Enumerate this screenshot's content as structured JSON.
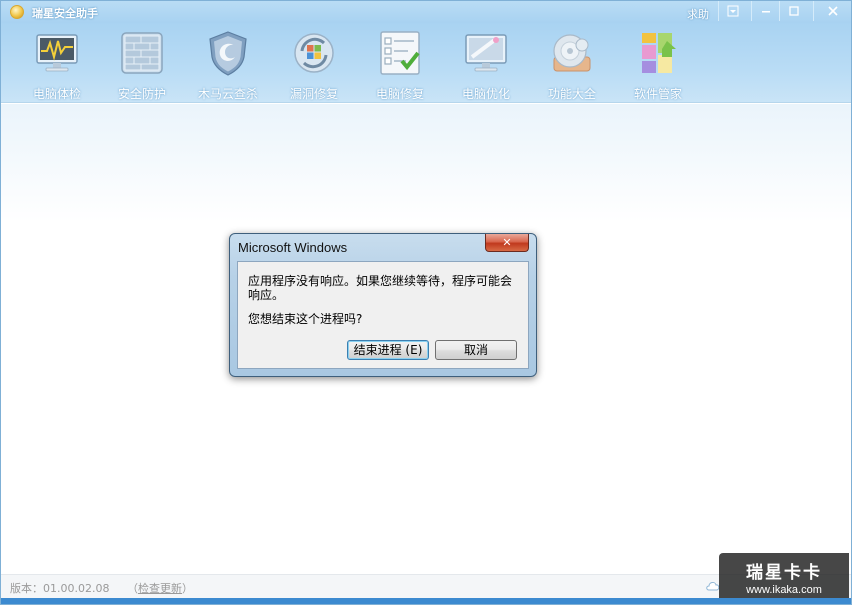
{
  "app": {
    "title": "瑞星安全助手",
    "help": "求助",
    "window_controls": [
      "▣",
      "—",
      "☐",
      "✕"
    ]
  },
  "toolbar": {
    "items": [
      {
        "label": "电脑体检",
        "icon": "monitor-pulse-icon"
      },
      {
        "label": "安全防护",
        "icon": "firewall-icon"
      },
      {
        "label": "木马云查杀",
        "icon": "shield-icon"
      },
      {
        "label": "漏洞修复",
        "icon": "windows-update-icon"
      },
      {
        "label": "电脑修复",
        "icon": "checklist-icon"
      },
      {
        "label": "电脑优化",
        "icon": "optimize-icon"
      },
      {
        "label": "功能大全",
        "icon": "discs-icon"
      },
      {
        "label": "软件管家",
        "icon": "software-blocks-icon"
      }
    ]
  },
  "status": {
    "version": "版本：01.00.02.08",
    "check_update": "检查更新",
    "open_paren": "（",
    "close_paren": "）"
  },
  "watermark": {
    "title": "瑞星卡卡",
    "url": "www.ikaka.com"
  },
  "dialog": {
    "title": "Microsoft Windows",
    "close": "✕",
    "message": "应用程序没有响应。如果您继续等待，程序可能会响应。",
    "question": "您想结束这个进程吗?",
    "end_process": "结束进程 (E)",
    "cancel": "取消"
  },
  "colors": {
    "titlebar": "#a8d2f1",
    "toolbar": "#b9dcf5",
    "dialog_close": "#c0391e",
    "bottom_strip": "#3c8ad0"
  }
}
